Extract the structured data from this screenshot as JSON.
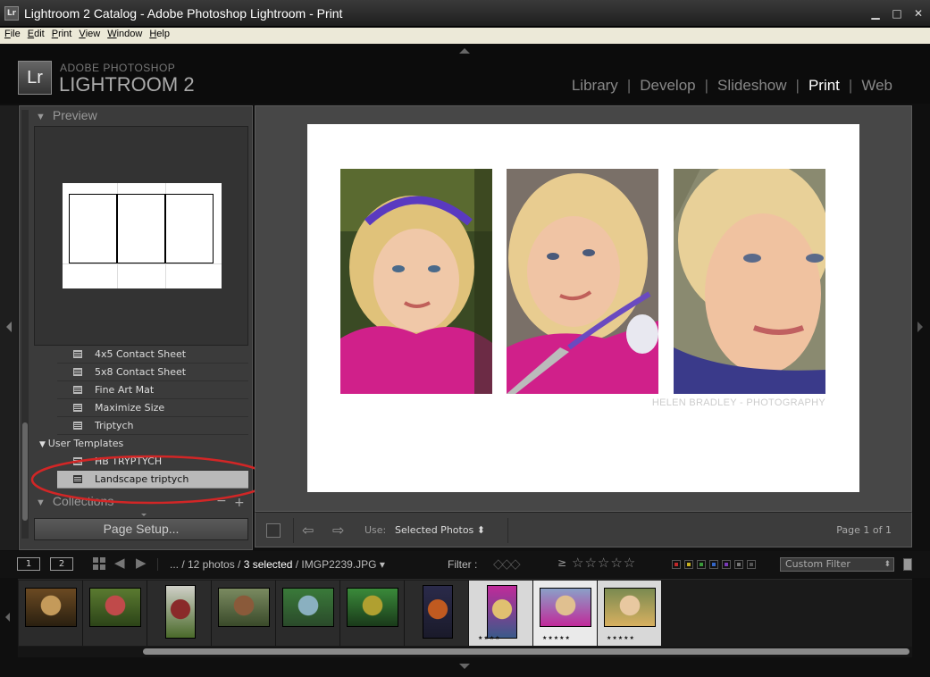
{
  "window": {
    "title": "Lightroom 2 Catalog - Adobe Photoshop Lightroom - Print",
    "app_icon_text": "Lr",
    "controls": [
      "minimize-icon",
      "maximize-icon",
      "close-icon"
    ]
  },
  "menu": {
    "items": [
      {
        "key": "F",
        "rest": "ile"
      },
      {
        "key": "E",
        "rest": "dit"
      },
      {
        "key": "P",
        "rest": "rint"
      },
      {
        "key": "V",
        "rest": "iew"
      },
      {
        "key": "W",
        "rest": "indow"
      },
      {
        "key": "H",
        "rest": "elp"
      }
    ]
  },
  "identity": {
    "logo": "Lr",
    "line1": "ADOBE PHOTOSHOP",
    "line2": "LIGHTROOM 2"
  },
  "modules": {
    "items": [
      "Library",
      "Develop",
      "Slideshow",
      "Print",
      "Web"
    ],
    "separator": "|",
    "active": "Print"
  },
  "left_panel": {
    "preview_header": "Preview",
    "templates": [
      {
        "label": "4x5 Contact Sheet"
      },
      {
        "label": "5x8 Contact Sheet"
      },
      {
        "label": "Fine Art Mat"
      },
      {
        "label": "Maximize Size"
      },
      {
        "label": "Triptych"
      }
    ],
    "user_templates_header": "User Templates",
    "user_templates": [
      {
        "label": "HB TRYPTYCH"
      },
      {
        "label": "Landscape triptych",
        "selected": true
      }
    ],
    "collections_header": "Collections",
    "collections_add": "+",
    "collections_remove": "−",
    "page_setup": "Page Setup..."
  },
  "center": {
    "watermark": "HELEN BRADLEY - PHOTOGRAPHY"
  },
  "toolbar": {
    "use_label": "Use:",
    "use_value": "Selected Photos",
    "use_arrows": "⬍",
    "page_status": "Page 1 of 1",
    "prev_icon": "arrow-left-icon",
    "next_icon": "arrow-right-icon"
  },
  "filmstrip_bar": {
    "page1": "1",
    "page2": "2",
    "path_prefix": "... / 12 photos / ",
    "path_selected": "3 selected",
    "path_suffix": " / IMGP2239.JPG",
    "path_dropdown": "▾",
    "filter_label": "Filter :",
    "flags": "◇◇◇",
    "rating_op": "≥",
    "stars": "☆☆☆☆☆",
    "color_labels": [
      "#c0282a",
      "#c8b020",
      "#3a9a3a",
      "#3466c8",
      "#7a3ab8",
      "#777777",
      "#555555"
    ],
    "custom_filter": "Custom Filter",
    "custom_filter_arrows": "⬍"
  },
  "filmstrip": {
    "thumbnails": [
      {
        "colors": [
          "#6b4a22",
          "#c49a5a",
          "#2a2010"
        ],
        "state": "normal",
        "stars": ""
      },
      {
        "colors": [
          "#5a7a30",
          "#c04a4a",
          "#2c4418"
        ],
        "state": "normal",
        "stars": ""
      },
      {
        "colors": [
          "#d0d0c8",
          "#8a2a2a",
          "#4a6a2a"
        ],
        "state": "normal",
        "stars": "",
        "tall": true
      },
      {
        "colors": [
          "#7a8a60",
          "#8a5a3a",
          "#3a4a2a"
        ],
        "state": "normal",
        "stars": ""
      },
      {
        "colors": [
          "#3a7a3a",
          "#8ab0c0",
          "#2a4a2a"
        ],
        "state": "normal",
        "stars": ""
      },
      {
        "colors": [
          "#3a8a3a",
          "#b0a030",
          "#1a3a1a"
        ],
        "state": "normal",
        "stars": ""
      },
      {
        "colors": [
          "#2a2a4a",
          "#c05a20",
          "#1a1a2a"
        ],
        "state": "normal",
        "stars": "",
        "tall": true
      },
      {
        "colors": [
          "#c02a9a",
          "#e0c070",
          "#3a5a8a"
        ],
        "state": "sel",
        "stars": "★★★★",
        "tall": true
      },
      {
        "colors": [
          "#8aa0c8",
          "#e0c090",
          "#c02a9a"
        ],
        "state": "cur",
        "stars": "★★★★★"
      },
      {
        "colors": [
          "#7a8a50",
          "#e8c8a0",
          "#d8b060"
        ],
        "state": "sel",
        "stars": "★★★★★"
      }
    ]
  },
  "colors": {
    "accent_active_module": "#ffffff",
    "annotation_ring": "#d22626",
    "selected_template_bg": "#b9b9b9"
  }
}
